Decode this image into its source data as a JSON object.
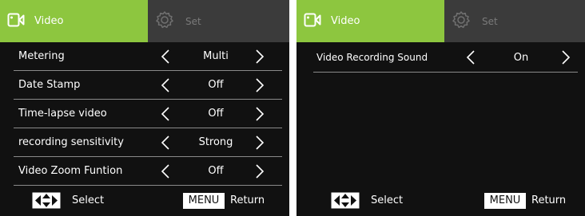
{
  "colors": {
    "accent": "#8dc63f",
    "background": "#111111",
    "tabbar": "#3b3b3b",
    "inactive_text": "#7a7a7a",
    "divider": "#8a8a8a"
  },
  "icons": {
    "video_tab": "video-camera-icon",
    "set_tab": "gear-icon",
    "nav": "four-way-arrow-icon",
    "prev": "chevron-left-icon",
    "next": "chevron-right-icon"
  },
  "left": {
    "tabs": {
      "video": "Video",
      "set": "Set"
    },
    "items": [
      {
        "label": "Metering",
        "value": "Multi"
      },
      {
        "label": "Date Stamp",
        "value": "Off"
      },
      {
        "label": "Time-lapse video",
        "value": "Off"
      },
      {
        "label": "recording sensitivity",
        "value": "Strong"
      },
      {
        "label": "Video Zoom Funtion",
        "value": "Off"
      }
    ],
    "footer": {
      "select": "Select",
      "menu": "MENU",
      "return": "Return"
    }
  },
  "right": {
    "tabs": {
      "video": "Video",
      "set": "Set"
    },
    "items": [
      {
        "label": "Video Recording Sound",
        "value": "On"
      }
    ],
    "footer": {
      "select": "Select",
      "menu": "MENU",
      "return": "Return"
    }
  }
}
